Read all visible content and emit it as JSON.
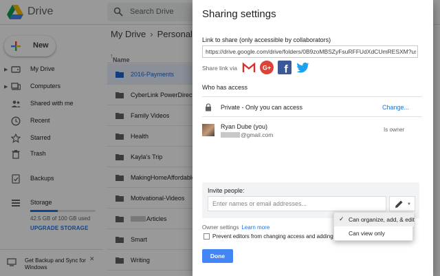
{
  "drive": {
    "app_name": "Drive",
    "search_placeholder": "Search Drive",
    "new_label": "New",
    "nav": [
      {
        "label": "My Drive",
        "icon": "drive-icon"
      },
      {
        "label": "Computers",
        "icon": "computer-icon"
      },
      {
        "label": "Shared with me",
        "icon": "people-icon"
      },
      {
        "label": "Recent",
        "icon": "clock-icon"
      },
      {
        "label": "Starred",
        "icon": "star-icon"
      },
      {
        "label": "Trash",
        "icon": "trash-icon"
      },
      {
        "label": "Backups",
        "icon": "backup-icon"
      },
      {
        "label": "Storage",
        "icon": "storage-icon"
      }
    ],
    "storage_text": "42.5 GB of 100 GB used",
    "storage_fraction": 0.425,
    "upgrade_label": "UPGRADE STORAGE",
    "backup_label": "Get Backup and Sync for Windows",
    "breadcrumb": [
      "My Drive",
      "Personal"
    ],
    "list_header": "Name",
    "folders": [
      {
        "name": "2016-Payments",
        "selected": true
      },
      {
        "name": "CyberLink PowerDirector"
      },
      {
        "name": "Family Videos"
      },
      {
        "name": "Health"
      },
      {
        "name": "Kayla's Trip"
      },
      {
        "name": "MakingHomeAffordable"
      },
      {
        "name": "Motivational-Videos"
      },
      {
        "name": "Articles",
        "redacted_prefix": true
      },
      {
        "name": "Smart"
      },
      {
        "name": "Writing"
      }
    ]
  },
  "dialog": {
    "title": "Sharing settings",
    "link_label": "Link to share (only accessible by collaborators)",
    "link_url": "https://drive.google.com/drive/folders/0B9zoMBSZyFsuRFFUdXdCUmRESXM?usp=s",
    "share_via_label": "Share link via",
    "share_icons": [
      "gmail-icon",
      "google-plus-icon",
      "facebook-icon",
      "twitter-icon"
    ],
    "who_has_access_label": "Who has access",
    "access_text": "Private - Only you can access",
    "change_label": "Change...",
    "person_name": "Ryan Dube (you)",
    "person_email_suffix": "@gmail.com",
    "person_role": "Is owner",
    "invite_label": "Invite people:",
    "invite_placeholder": "Enter names or email addresses...",
    "owner_settings_label": "Owner settings",
    "learn_more_label": "Learn more",
    "prevent_label": "Prevent editors from changing access and adding new",
    "done_label": "Done"
  },
  "menu": {
    "items": [
      {
        "label": "Can organize, add, & edit",
        "checked": "✓"
      },
      {
        "label": "Can view only",
        "checked": ""
      }
    ]
  },
  "colors": {
    "accent": "#1a73e8",
    "done_button": "#4285f4",
    "selected_row": "#e8f0fe"
  }
}
